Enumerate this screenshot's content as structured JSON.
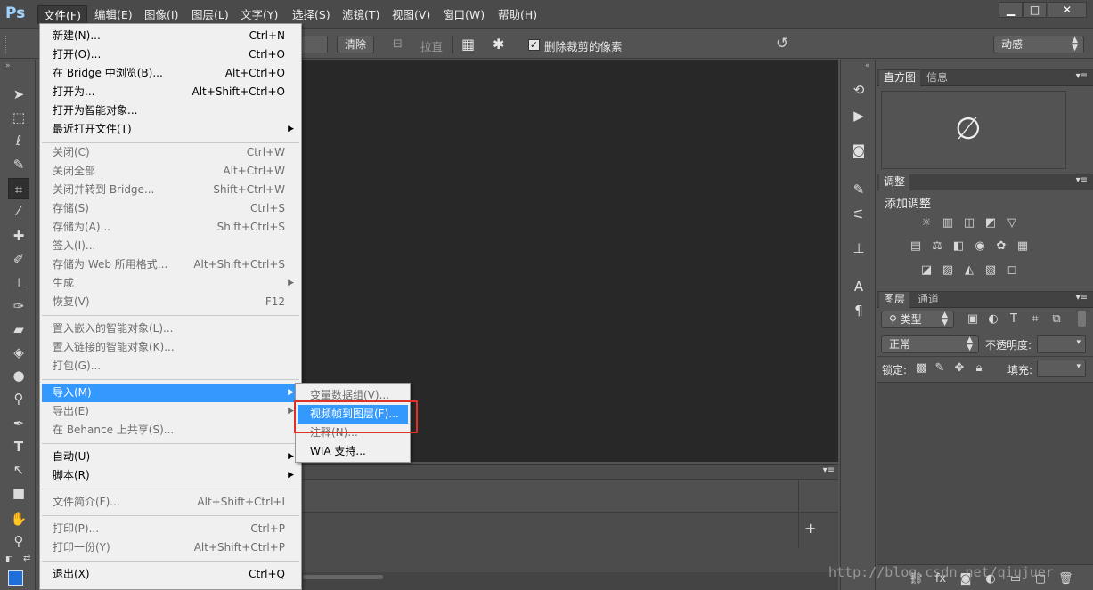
{
  "app": {
    "logo": "Ps"
  },
  "menubar": {
    "items": [
      "文件(F)",
      "编辑(E)",
      "图像(I)",
      "图层(L)",
      "文字(Y)",
      "选择(S)",
      "滤镜(T)",
      "视图(V)",
      "窗口(W)",
      "帮助(H)"
    ],
    "window_buttons": {
      "minimize": "▁",
      "maximize": "□",
      "close": "✕"
    }
  },
  "optionsbar": {
    "clear_button": "清除",
    "straighten_label": "拉直",
    "delete_cropped_label": "删除裁剪的像素",
    "delete_cropped_checked": true,
    "workspace_select": "动感"
  },
  "file_menu": {
    "groups": [
      [
        {
          "label": "新建(N)...",
          "shortcut": "Ctrl+N",
          "disabled": false
        },
        {
          "label": "打开(O)...",
          "shortcut": "Ctrl+O",
          "disabled": false
        },
        {
          "label": "在 Bridge 中浏览(B)...",
          "shortcut": "Alt+Ctrl+O",
          "disabled": false
        },
        {
          "label": "打开为...",
          "shortcut": "Alt+Shift+Ctrl+O",
          "disabled": false
        },
        {
          "label": "打开为智能对象...",
          "shortcut": "",
          "disabled": false
        },
        {
          "label": "最近打开文件(T)",
          "shortcut": "",
          "disabled": false,
          "submenu": true
        }
      ],
      [
        {
          "label": "关闭(C)",
          "shortcut": "Ctrl+W",
          "disabled": true
        },
        {
          "label": "关闭全部",
          "shortcut": "Alt+Ctrl+W",
          "disabled": true
        },
        {
          "label": "关闭并转到 Bridge...",
          "shortcut": "Shift+Ctrl+W",
          "disabled": true
        },
        {
          "label": "存储(S)",
          "shortcut": "Ctrl+S",
          "disabled": true
        },
        {
          "label": "存储为(A)...",
          "shortcut": "Shift+Ctrl+S",
          "disabled": true
        },
        {
          "label": "签入(I)...",
          "shortcut": "",
          "disabled": true
        },
        {
          "label": "存储为 Web 所用格式...",
          "shortcut": "Alt+Shift+Ctrl+S",
          "disabled": true
        },
        {
          "label": "生成",
          "shortcut": "",
          "disabled": true,
          "submenu": true
        },
        {
          "label": "恢复(V)",
          "shortcut": "F12",
          "disabled": true
        }
      ],
      [
        {
          "label": "置入嵌入的智能对象(L)...",
          "shortcut": "",
          "disabled": true
        },
        {
          "label": "置入链接的智能对象(K)...",
          "shortcut": "",
          "disabled": true
        },
        {
          "label": "打包(G)...",
          "shortcut": "",
          "disabled": true
        }
      ],
      [
        {
          "label": "导入(M)",
          "shortcut": "",
          "disabled": false,
          "submenu": true,
          "highlighted": true
        },
        {
          "label": "导出(E)",
          "shortcut": "",
          "disabled": true,
          "submenu": true
        },
        {
          "label": "在 Behance 上共享(S)...",
          "shortcut": "",
          "disabled": true
        }
      ],
      [
        {
          "label": "自动(U)",
          "shortcut": "",
          "disabled": false,
          "submenu": true
        },
        {
          "label": "脚本(R)",
          "shortcut": "",
          "disabled": false,
          "submenu": true
        }
      ],
      [
        {
          "label": "文件简介(F)...",
          "shortcut": "Alt+Shift+Ctrl+I",
          "disabled": true
        }
      ],
      [
        {
          "label": "打印(P)...",
          "shortcut": "Ctrl+P",
          "disabled": true
        },
        {
          "label": "打印一份(Y)",
          "shortcut": "Alt+Shift+Ctrl+P",
          "disabled": true
        }
      ],
      [
        {
          "label": "退出(X)",
          "shortcut": "Ctrl+Q",
          "disabled": false
        }
      ]
    ]
  },
  "import_submenu": [
    {
      "label": "变量数据组(V)...",
      "disabled": true
    },
    {
      "label": "视频帧到图层(F)...",
      "disabled": false,
      "highlighted": true
    },
    {
      "label": "注释(N)...",
      "disabled": true
    },
    {
      "label": "WIA 支持...",
      "disabled": false
    }
  ],
  "panels": {
    "histogram": {
      "tabs": [
        "直方图",
        "信息"
      ],
      "symbol": "∅"
    },
    "adjustments": {
      "tabs": [
        "调整"
      ],
      "heading": "添加调整"
    },
    "layers": {
      "tabs": [
        "图层",
        "通道"
      ],
      "filter_kind": "类型",
      "blend_mode": "正常",
      "opacity_label": "不透明度:",
      "lock_label": "锁定:",
      "fill_label": "填充:"
    }
  },
  "timeline": {
    "add_symbol": "+"
  },
  "watermark": "http://blog.csdn.net/qiujuer",
  "colors": {
    "highlight": "#3399ff",
    "annotation_box": "#e0302a",
    "foreground_swatch": "#1e6fd9"
  }
}
